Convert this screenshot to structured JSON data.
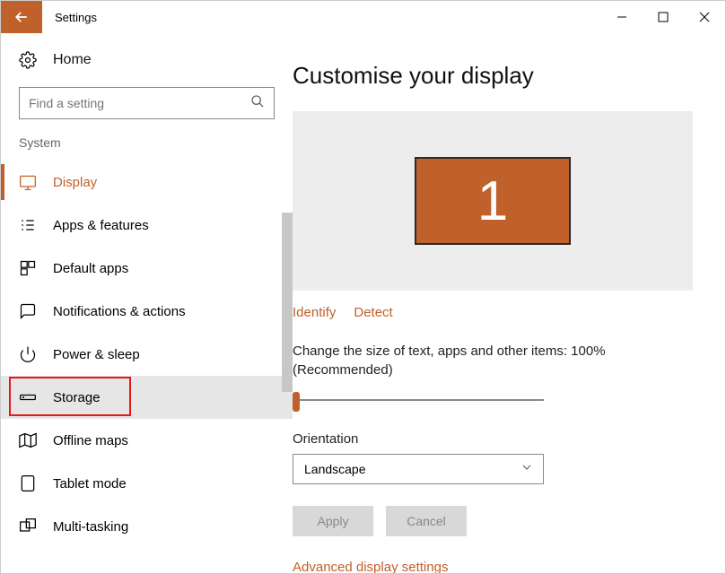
{
  "title": "Settings",
  "home": {
    "label": "Home"
  },
  "search": {
    "placeholder": "Find a setting"
  },
  "section": "System",
  "nav": [
    {
      "label": "Display"
    },
    {
      "label": "Apps & features"
    },
    {
      "label": "Default apps"
    },
    {
      "label": "Notifications & actions"
    },
    {
      "label": "Power & sleep"
    },
    {
      "label": "Storage"
    },
    {
      "label": "Offline maps"
    },
    {
      "label": "Tablet mode"
    },
    {
      "label": "Multi-tasking"
    }
  ],
  "main": {
    "heading": "Customise your display",
    "monitor_number": "1",
    "identify": "Identify",
    "detect": "Detect",
    "scale_label": "Change the size of text, apps and other items: 100% (Recommended)",
    "orientation_label": "Orientation",
    "orientation_value": "Landscape",
    "apply": "Apply",
    "cancel": "Cancel",
    "advanced": "Advanced display settings"
  }
}
